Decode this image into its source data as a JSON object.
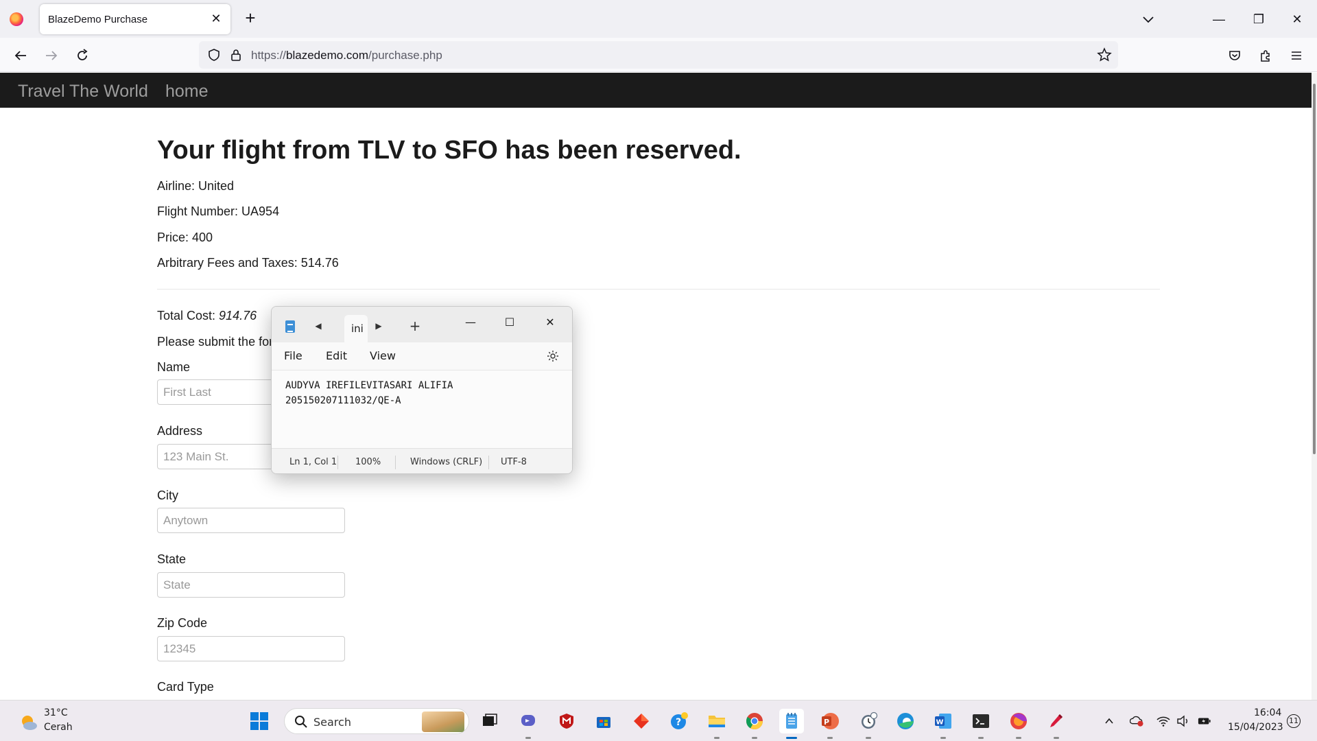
{
  "browser": {
    "tab_title": "BlazeDemo Purchase",
    "url_prefix": "https://",
    "url_host": "blazedemo.com",
    "url_path": "/purchase.php"
  },
  "site": {
    "brand": "Travel The World",
    "home_link": "home"
  },
  "page": {
    "heading": "Your flight from TLV to SFO has been reserved.",
    "airline": "Airline: United",
    "flight_number": "Flight Number: UA954",
    "price": "Price: 400",
    "fees": "Arbitrary Fees and Taxes: 514.76",
    "total_label": "Total Cost: ",
    "total_value": "914.76",
    "submit_prompt": "Please submit the form below to purchase the flight.",
    "form": {
      "name_label": "Name",
      "name_placeholder": "First Last",
      "address_label": "Address",
      "address_placeholder": "123 Main St.",
      "city_label": "City",
      "city_placeholder": "Anytown",
      "state_label": "State",
      "state_placeholder": "State",
      "zip_label": "Zip Code",
      "zip_placeholder": "12345",
      "card_label": "Card Type"
    }
  },
  "notepad": {
    "tab_label": "ini",
    "menu": [
      "File",
      "Edit",
      "View"
    ],
    "lines": [
      "AUDYVA IREFILEVITASARI ALIFIA",
      "205150207111032/QE-A"
    ],
    "status": {
      "position": "Ln 1, Col 1",
      "zoom": "100%",
      "line_ending": "Windows (CRLF)",
      "encoding": "UTF-8"
    }
  },
  "taskbar": {
    "weather_temp": "31°C",
    "weather_desc": "Cerah",
    "search_label": "Search",
    "time": "16:04",
    "date": "15/04/2023",
    "notifications": "11"
  },
  "colors": {
    "site_nav_bg": "#1b1b1b",
    "site_nav_text": "#9d9d9d",
    "accent": "#0067c0"
  }
}
